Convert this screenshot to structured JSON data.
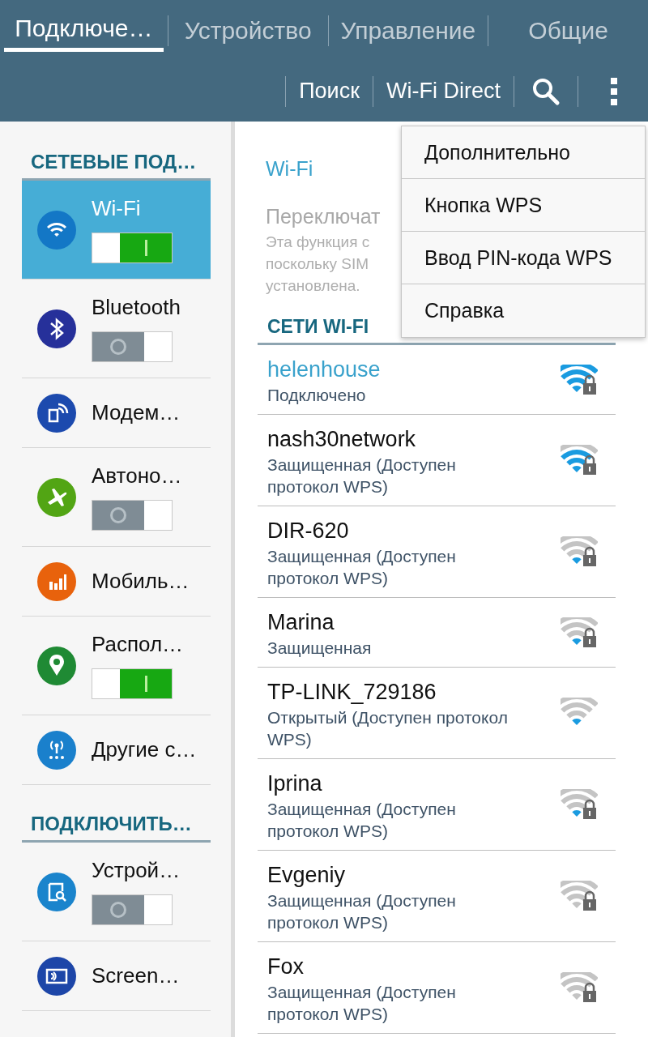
{
  "tabs": [
    {
      "label": "Подключе…",
      "selected": true
    },
    {
      "label": "Устройство",
      "selected": false
    },
    {
      "label": "Управление",
      "selected": false
    },
    {
      "label": "Общие",
      "selected": false
    }
  ],
  "actions": [
    "Поиск",
    "Wi-Fi Direct"
  ],
  "sidebar": {
    "sections": [
      {
        "title": "СЕТЕВЫЕ ПОД…",
        "items": [
          {
            "label": "Wi-Fi",
            "kind": "toggle",
            "on": true,
            "selected": true,
            "color": "#1377c6"
          },
          {
            "label": "Bluetooth",
            "kind": "toggle",
            "on": false,
            "selected": false,
            "color": "#26309a"
          },
          {
            "label": "Модем…",
            "kind": "link",
            "selected": false,
            "color": "#1c4aae"
          },
          {
            "label": "Автоно…",
            "kind": "toggle",
            "on": false,
            "selected": false,
            "color": "#52a514"
          },
          {
            "label": "Мобиль…",
            "kind": "link",
            "selected": false,
            "color": "#e8620c"
          },
          {
            "label": "Распол…",
            "kind": "toggle",
            "on": true,
            "selected": false,
            "color": "#1f8a34"
          },
          {
            "label": "Другие с…",
            "kind": "link",
            "selected": false,
            "color": "#1a80cc"
          }
        ]
      },
      {
        "title": "ПОДКЛЮЧИТЬ…",
        "items": [
          {
            "label": "Устрой…",
            "kind": "toggle",
            "on": false,
            "selected": false,
            "color": "#1a84cc"
          },
          {
            "label": "Screen…",
            "kind": "link",
            "selected": false,
            "color": "#1d46a8"
          }
        ]
      }
    ]
  },
  "detail": {
    "title": "Wi-Fi",
    "setting": "Переключат",
    "note_lines": [
      "Эта функция с",
      "поскольку SIM",
      "установлена."
    ]
  },
  "networks_header": "СЕТИ WI-FI",
  "networks": [
    {
      "name": "helenhouse",
      "status": "Подключено",
      "connected": true,
      "kind": "full",
      "secured": true
    },
    {
      "name": "nash30network",
      "status": "Защищенная (Доступен протокол WPS)",
      "connected": false,
      "kind": "good",
      "secured": true
    },
    {
      "name": "DIR-620",
      "status": "Защищенная (Доступен протокол WPS)",
      "connected": false,
      "kind": "low",
      "secured": true
    },
    {
      "name": "Marina",
      "status": "Защищенная",
      "connected": false,
      "kind": "low",
      "secured": true
    },
    {
      "name": "TP-LINK_729186",
      "status": "Открытый (Доступен протокол WPS)",
      "connected": false,
      "kind": "low",
      "secured": false
    },
    {
      "name": "Iprina",
      "status": "Защищенная (Доступен протокол WPS)",
      "connected": false,
      "kind": "low",
      "secured": true
    },
    {
      "name": "Evgeniy",
      "status": "Защищенная (Доступен протокол WPS)",
      "connected": false,
      "kind": "none",
      "secured": true
    },
    {
      "name": "Fox",
      "status": "Защищенная (Доступен протокол WPS)",
      "connected": false,
      "kind": "none",
      "secured": true
    }
  ],
  "menu": {
    "items": [
      "Дополнительно",
      "Кнопка WPS",
      "Ввод PIN-кода WPS",
      "Справка"
    ]
  }
}
